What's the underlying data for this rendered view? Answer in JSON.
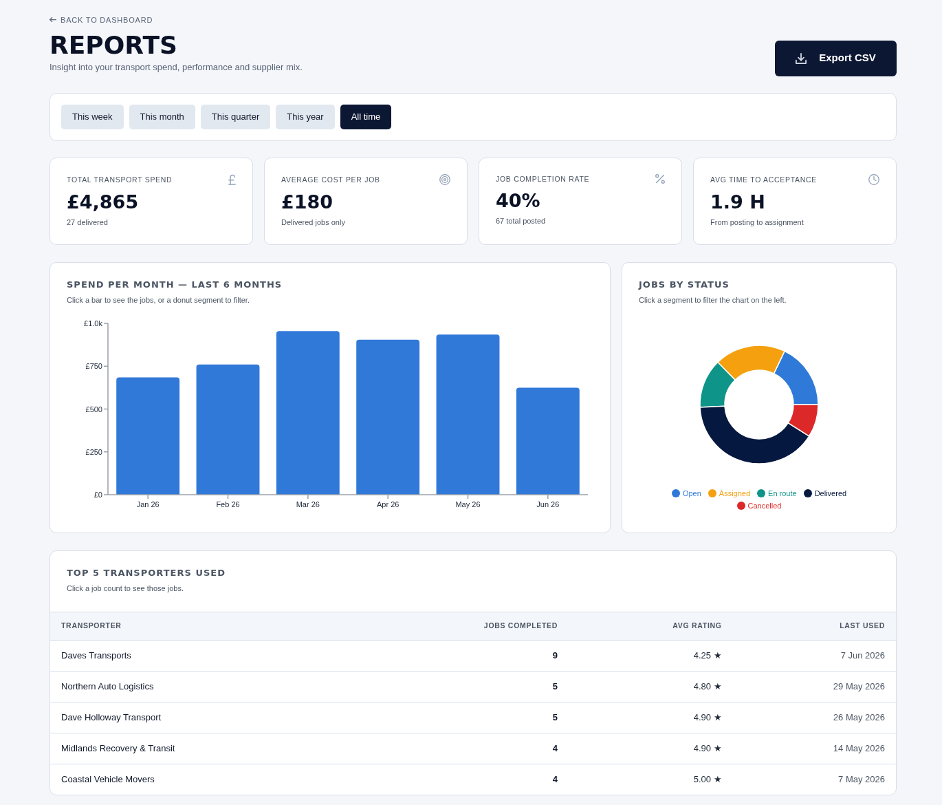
{
  "back_link": {
    "label": "BACK TO DASHBOARD"
  },
  "header": {
    "title": "REPORTS",
    "subtitle": "Insight into your transport spend, performance and supplier mix.",
    "export_button": "Export CSV"
  },
  "period_filter": [
    {
      "label": "This week",
      "selected": false
    },
    {
      "label": "This month",
      "selected": false
    },
    {
      "label": "This quarter",
      "selected": false
    },
    {
      "label": "This year",
      "selected": false
    },
    {
      "label": "All time",
      "selected": true
    }
  ],
  "kpis": [
    {
      "label": "TOTAL TRANSPORT SPEND",
      "value": "£4,865",
      "note": "27 delivered"
    },
    {
      "label": "AVERAGE COST PER JOB",
      "value": "£180",
      "note": "Delivered jobs only"
    },
    {
      "label": "JOB COMPLETION RATE",
      "value": "40%",
      "note": "67 total posted"
    },
    {
      "label": "AVG TIME TO ACCEPTANCE",
      "value": "1.9 H",
      "note": "From posting to assignment"
    }
  ],
  "spend_chart": {
    "title": "SPEND PER MONTH — LAST 6 MONTHS",
    "subtitle": "Click a bar to see the jobs, or a donut segment to filter.",
    "chart_data": {
      "type": "bar",
      "categories": [
        "Jan 26",
        "Feb 26",
        "Mar 26",
        "Apr 26",
        "May 26",
        "Jun 26"
      ],
      "values": [
        685,
        760,
        955,
        905,
        935,
        625
      ],
      "ylim": [
        0,
        1000
      ],
      "yticks": [
        {
          "value": 0,
          "label": "£0"
        },
        {
          "value": 250,
          "label": "£250"
        },
        {
          "value": 500,
          "label": "£500"
        },
        {
          "value": 750,
          "label": "£750"
        },
        {
          "value": 1000,
          "label": "£1.0k"
        }
      ]
    }
  },
  "status_chart": {
    "title": "JOBS BY STATUS",
    "subtitle": "Click a segment to filter the chart on the left.",
    "legend": [
      {
        "label": "Open",
        "color": "#2f7ad8"
      },
      {
        "label": "Assigned",
        "color": "#f4a00f"
      },
      {
        "label": "En route",
        "color": "#0e9488"
      },
      {
        "label": "Delivered",
        "color": "#05183f"
      },
      {
        "label": "Cancelled",
        "color": "#dc2828"
      }
    ]
  },
  "transporters": {
    "title": "TOP 5 TRANSPORTERS USED",
    "subtitle": "Click a job count to see those jobs.",
    "columns": [
      "TRANSPORTER",
      "JOBS COMPLETED",
      "AVG RATING",
      "LAST USED"
    ],
    "rows": [
      {
        "transporter": "Daves Transports",
        "jobs_completed": "9",
        "avg_rating": "4.25 ★",
        "last_used": "7 Jun 2026"
      },
      {
        "transporter": "Northern Auto Logistics",
        "jobs_completed": "5",
        "avg_rating": "4.80 ★",
        "last_used": "29 May 2026"
      },
      {
        "transporter": "Dave Holloway Transport",
        "jobs_completed": "5",
        "avg_rating": "4.90 ★",
        "last_used": "26 May 2026"
      },
      {
        "transporter": "Midlands Recovery & Transit",
        "jobs_completed": "4",
        "avg_rating": "4.90 ★",
        "last_used": "14 May 2026"
      },
      {
        "transporter": "Coastal Vehicle Movers",
        "jobs_completed": "4",
        "avg_rating": "5.00 ★",
        "last_used": "7 May 2026"
      }
    ]
  }
}
